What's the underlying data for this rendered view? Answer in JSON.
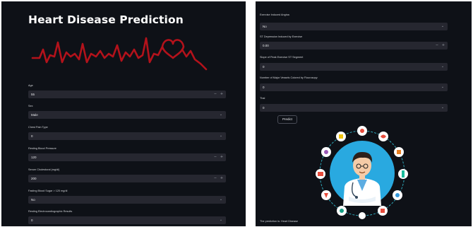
{
  "left": {
    "title": "Heart Disease Prediction",
    "fields": [
      {
        "label": "Age",
        "value": "55",
        "kind": "number"
      },
      {
        "label": "Sex",
        "value": "Male",
        "kind": "select"
      },
      {
        "label": "Chest Pain Type",
        "value": "0",
        "kind": "select"
      },
      {
        "label": "Resting Blood Pressure",
        "value": "120",
        "kind": "number"
      },
      {
        "label": "Serum Cholestoral (mg/dl)",
        "value": "200",
        "kind": "number"
      },
      {
        "label": "Fasting Blood Sugar > 120 mg/dl",
        "value": "No",
        "kind": "select"
      },
      {
        "label": "Resting Electrocardiographic Results",
        "value": "0",
        "kind": "select"
      }
    ]
  },
  "right": {
    "fields": [
      {
        "label": "Exercise Induced Angina",
        "value": "No",
        "kind": "select"
      },
      {
        "label": "ST Depression Induced by Exercise",
        "value": "0.00",
        "kind": "number"
      },
      {
        "label": "Slope of Peak Exercise ST Segment",
        "value": "0",
        "kind": "select"
      },
      {
        "label": "Number of Major Vessels Colored by Flourosopy",
        "value": "0",
        "kind": "select"
      },
      {
        "label": "Thal",
        "value": "0",
        "kind": "select"
      }
    ],
    "predict_label": "Predict",
    "bottom_text": "The prediction is: Heart Disease"
  },
  "icons": {
    "chevron": "chevron-down-icon",
    "stepper": "stepper-icon",
    "heartbeat": "heartbeat-line-icon",
    "doctor": "doctor-illustration"
  },
  "colors": {
    "background": "#0e1117",
    "field": "#262730",
    "ecg": "#b3121b",
    "circle": "#29a9e0"
  }
}
